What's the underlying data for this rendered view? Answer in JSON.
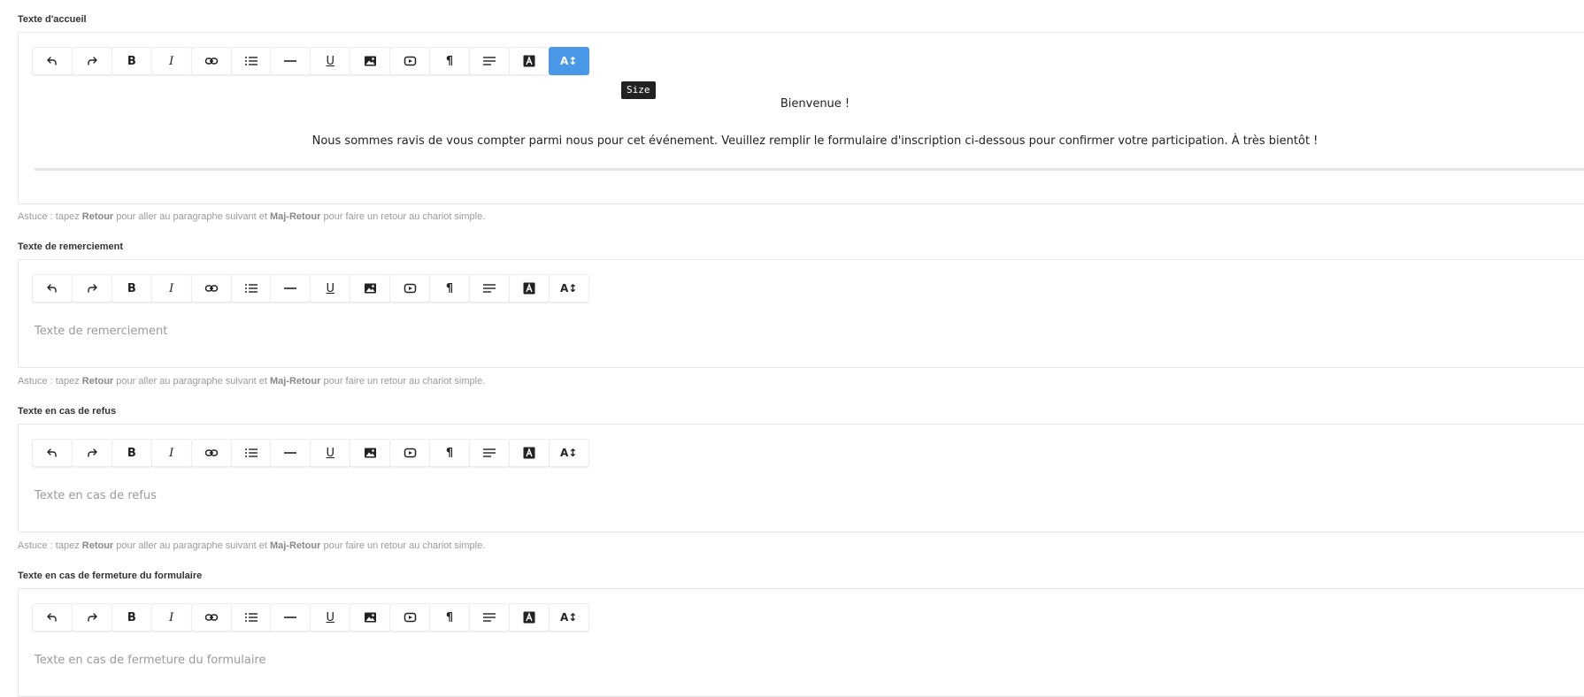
{
  "toolbar": {
    "buttons": [
      {
        "name": "undo-button",
        "icon": "undo-icon"
      },
      {
        "name": "redo-button",
        "icon": "redo-icon"
      },
      {
        "name": "bold-button",
        "icon": "bold-icon",
        "glyph": "B"
      },
      {
        "name": "italic-button",
        "icon": "italic-icon",
        "glyph": "I"
      },
      {
        "name": "link-button",
        "icon": "link-icon"
      },
      {
        "name": "bullet-list-button",
        "icon": "list-icon"
      },
      {
        "name": "horizontal-rule-button",
        "icon": "horizontal-rule-icon"
      },
      {
        "name": "underline-button",
        "icon": "underline-icon",
        "glyph": "U"
      },
      {
        "name": "image-button",
        "icon": "image-icon"
      },
      {
        "name": "video-button",
        "icon": "video-icon"
      },
      {
        "name": "paragraph-button",
        "icon": "pilcrow-icon",
        "glyph": "¶"
      },
      {
        "name": "align-button",
        "icon": "align-left-icon"
      },
      {
        "name": "text-color-button",
        "icon": "text-color-icon",
        "glyph": "A"
      },
      {
        "name": "font-size-button",
        "icon": "font-size-icon",
        "glyph": "A↕"
      }
    ],
    "tooltip": "Size",
    "active_color": "#4a98e8"
  },
  "sections": [
    {
      "label": "Texte d'accueil",
      "content_title": "Bienvenue !",
      "content_body": "Nous sommes ravis de vous compter parmi nous pour cet événement. Veuillez remplir le formulaire d'inscription ci-dessous pour confirmer votre participation. À très bientôt !",
      "hint_prefix": "Astuce : tapez ",
      "hint_key1": "Retour",
      "hint_mid": " pour aller au paragraphe suivant et ",
      "hint_key2": "Maj-Retour",
      "hint_suffix": " pour faire un retour au chariot simple."
    },
    {
      "label": "Texte de remerciement",
      "placeholder": "Texte de remerciement",
      "hint_prefix": "Astuce : tapez ",
      "hint_key1": "Retour",
      "hint_mid": " pour aller au paragraphe suivant et ",
      "hint_key2": "Maj-Retour",
      "hint_suffix": " pour faire un retour au chariot simple."
    },
    {
      "label": "Texte en cas de refus",
      "placeholder": "Texte en cas de refus",
      "hint_prefix": "Astuce : tapez ",
      "hint_key1": "Retour",
      "hint_mid": " pour aller au paragraphe suivant et ",
      "hint_key2": "Maj-Retour",
      "hint_suffix": " pour faire un retour au chariot simple."
    },
    {
      "label": "Texte en cas de fermeture du formulaire",
      "placeholder": "Texte en cas de fermeture du formulaire"
    }
  ]
}
